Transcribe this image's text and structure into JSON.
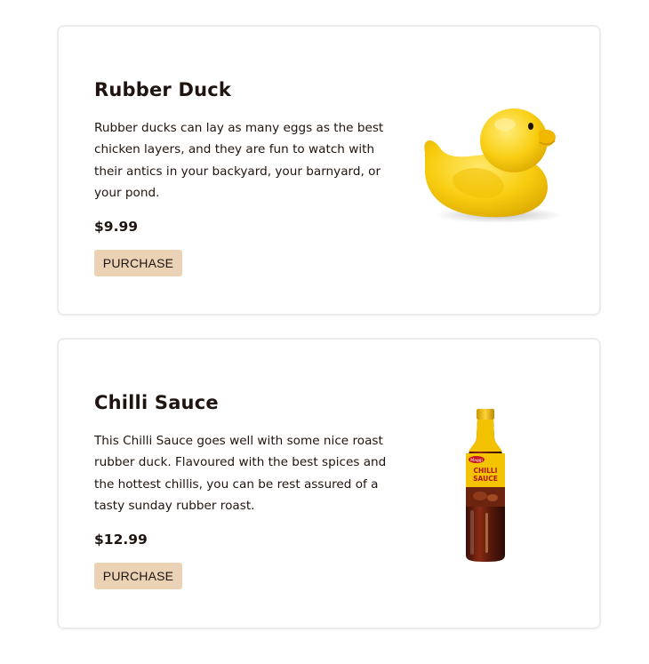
{
  "products": [
    {
      "title": "Rubber Duck",
      "description": "Rubber ducks can lay as many eggs as the best chicken layers, and they are fun to watch with their antics in your backyard, your barnyard, or your pond.",
      "price": "$9.99",
      "button_label": "PURCHASE",
      "image": "rubber-duck-image"
    },
    {
      "title": "Chilli Sauce",
      "description": "This Chilli Sauce goes well with some nice roast rubber duck. Flavoured with the best spices and the hottest chillis, you can be rest assured of a tasty sunday rubber roast.",
      "price": "$12.99",
      "button_label": "PURCHASE",
      "image": "chilli-sauce-bottle-image",
      "label_lines": [
        "Maggi",
        "CHILLI",
        "SAUCE"
      ]
    }
  ],
  "colors": {
    "text": "#1f140f",
    "button_bg": "#ebd2b5",
    "card_border": "#ececec"
  }
}
